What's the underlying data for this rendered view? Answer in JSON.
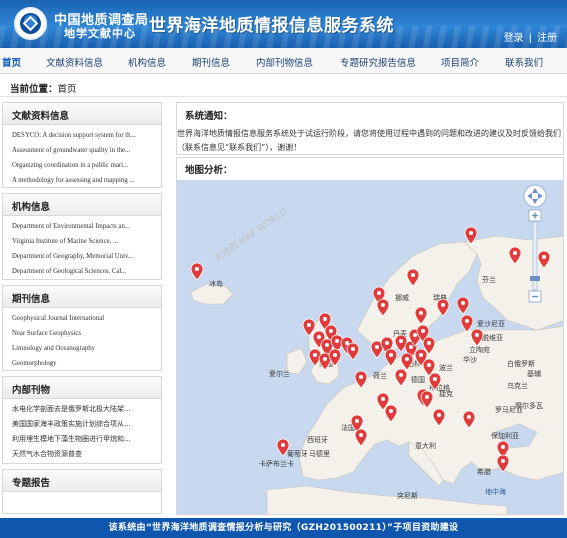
{
  "header": {
    "org_line1": "中国地质调查局",
    "org_line2": "地学文献中心",
    "site_title": "世界海洋地质情报信息服务系统",
    "login": "登录",
    "separator": "|",
    "register": "注册"
  },
  "nav": [
    "首页",
    "文献资料信息",
    "机构信息",
    "期刊信息",
    "内部刊物信息",
    "专题研究报告信息",
    "项目简介",
    "联系我们"
  ],
  "breadcrumb": {
    "label": "当前位置：",
    "current": "首页"
  },
  "sidebar": {
    "docs": {
      "title": "文献资料信息",
      "items": [
        "DESYCO: A decision support system for th...",
        "Assessment of groundwater quality in the...",
        "Organizing coordination in a public mari...",
        "A methodology for assessing and mapping ..."
      ]
    },
    "institutions": {
      "title": "机构信息",
      "items": [
        "Department of Environmental Impacts an...",
        "Virginia Institute of Marine Science, ...",
        "Department of Geography, Memorial Univ...",
        "Department of Geological Sciences, Cal..."
      ]
    },
    "journals": {
      "title": "期刊信息",
      "items": [
        "Geophysical Journal International",
        "Near Surface Geophysics",
        "Limnology and Oceanography",
        "Geomorphology"
      ]
    },
    "internal": {
      "title": "内部刊物",
      "items": [
        "水电化学剖面去是俄罗斯北极大陆架...",
        "美国国家海丰政策实施计划综合项从...",
        "利用埋生模地下藻生物圈进行甲烷和...",
        "天然气水合物资源普查"
      ]
    },
    "reports": {
      "title": "专题报告"
    }
  },
  "notice": {
    "title": "系统通知：",
    "text": "世界海洋地质情报信息服务系统处于试运行阶段，请您将使用过程中遇到的问题和改进的建议及时反馈给我们（联系信息见“联系我们”），谢谢！"
  },
  "map": {
    "title": "地图分析：",
    "labels": [
      "冰岛",
      "挪威",
      "瑞典",
      "芬兰",
      "爱沙尼亚",
      "拉脱维亚",
      "丹麦",
      "立陶宛",
      "白俄罗斯",
      "爱尔兰",
      "英国",
      "荷兰",
      "柏林",
      "波兰",
      "德国",
      "捷克",
      "乌克兰",
      "摩尔多瓦",
      "法国",
      "罗马尼亚",
      "意大利",
      "保加利亚",
      "西班牙",
      "马德里",
      "葡萄牙",
      "希腊",
      "突尼斯",
      "地中海",
      "卡萨布兰卡",
      "基辅",
      "华沙",
      "布拉格"
    ],
    "watermark": "天地图 MAP WORLD",
    "colors": {
      "sea": "#c7d8ef",
      "land": "#f4f1ea",
      "marker": "#e23b3b"
    }
  },
  "footer": {
    "text": "该系统由“世界海洋地质调查情报分析与研究（GZH201500211）”子项目资助建设"
  }
}
